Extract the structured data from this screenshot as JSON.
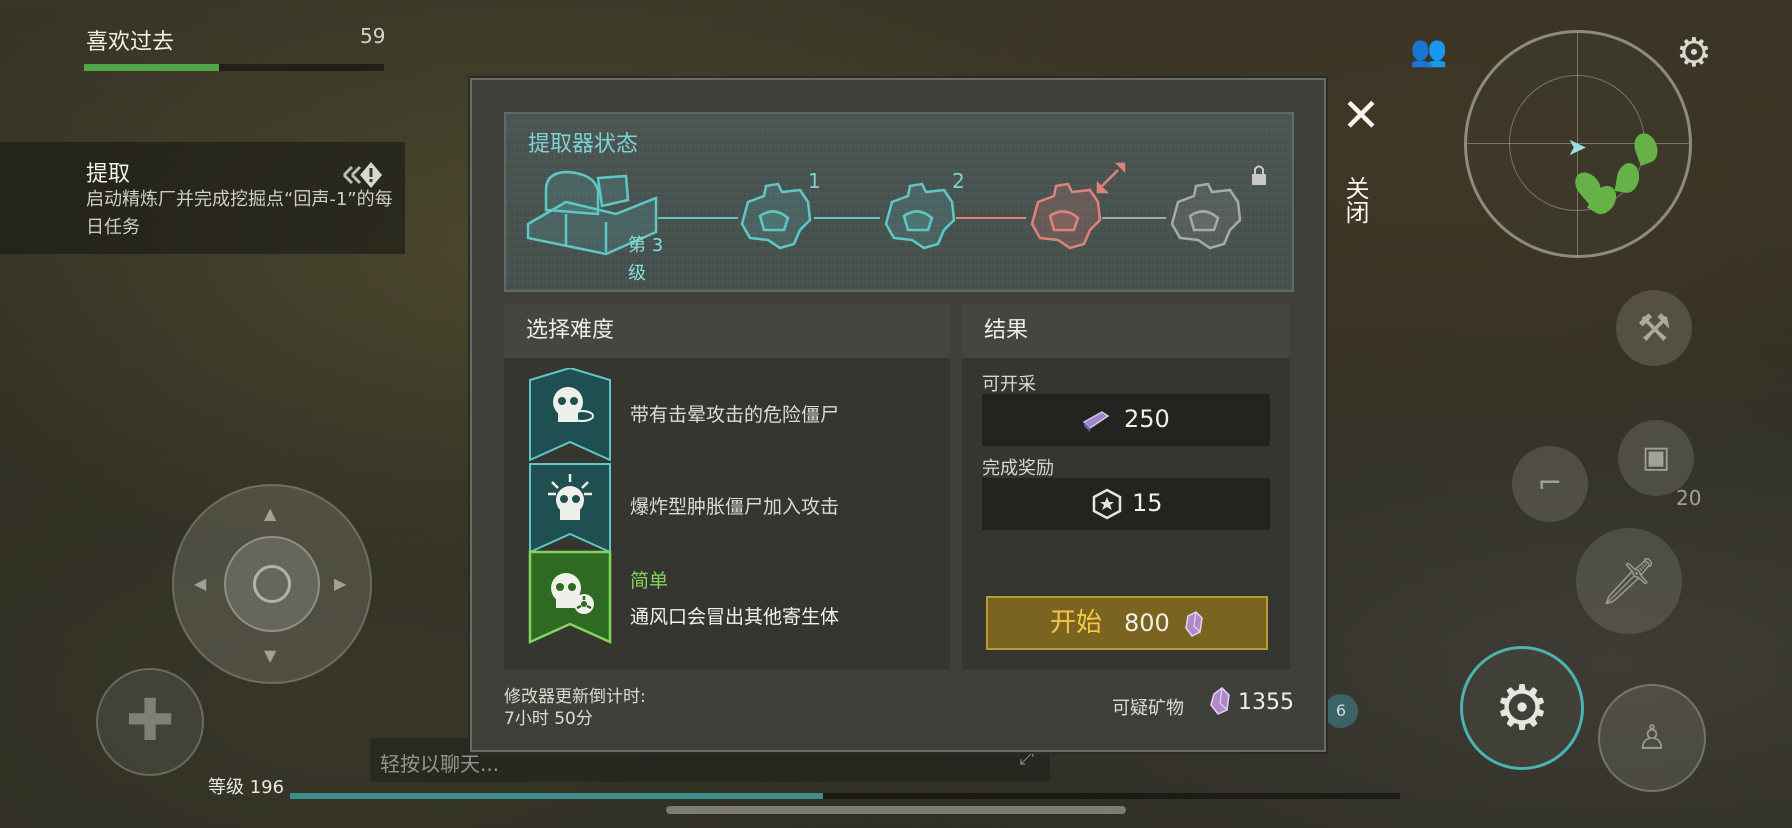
{
  "hud": {
    "player_name": "喜欢过去",
    "xp_value": "59",
    "quest": {
      "title": "提取",
      "description": "启动精炼厂并完成挖掘点“回声-1”的每日任务"
    },
    "chat_placeholder": "轻按以聊天...",
    "level_text": "等级 196",
    "box_count": "20",
    "badge_count": "6"
  },
  "dialog": {
    "close_label": "关闭",
    "status_title": "提取器状态",
    "current_level_label": "第 3 级",
    "stages": [
      {
        "label": "",
        "state": "current"
      },
      {
        "label": "1",
        "state": "active"
      },
      {
        "label": "2",
        "state": "active"
      },
      {
        "label": "",
        "state": "danger"
      },
      {
        "label": "",
        "state": "locked"
      }
    ],
    "difficulty": {
      "title": "选择难度",
      "rows": [
        {
          "tier": "",
          "text": "带有击晕攻击的危险僵尸",
          "selected": false
        },
        {
          "tier": "",
          "text": "爆炸型肿胀僵尸加入攻击",
          "selected": false
        },
        {
          "tier": "简单",
          "text": "通风口会冒出其他寄生体",
          "selected": true
        }
      ]
    },
    "results": {
      "title": "结果",
      "minable_label": "可开采",
      "minable_value": "250",
      "reward_label": "完成奖励",
      "reward_value": "15",
      "start_label": "开始",
      "start_cost": "800"
    },
    "timer_label": "修改器更新倒计时:",
    "timer_value": "7小时 50分",
    "mineral_label": "可疑矿物",
    "mineral_value": "1355"
  },
  "colors": {
    "teal": "#5ec8c6",
    "danger": "#e0827a",
    "locked": "#a8aaa6",
    "green": "#6fc04a",
    "gold": "#b89a3a"
  }
}
